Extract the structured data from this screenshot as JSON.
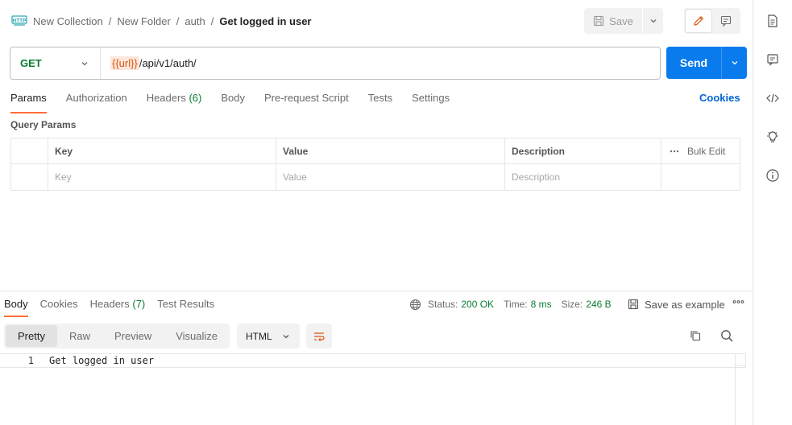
{
  "breadcrumb": {
    "items": [
      "New Collection",
      "New Folder",
      "auth"
    ],
    "separator": "/",
    "current": "Get logged in user"
  },
  "toolbar": {
    "save_label": "Save"
  },
  "request": {
    "method": "GET",
    "url_variable": "{{url}}",
    "url_path": "/api/v1/auth/",
    "send_label": "Send"
  },
  "request_tabs": [
    {
      "label": "Params",
      "count": ""
    },
    {
      "label": "Authorization",
      "count": ""
    },
    {
      "label": "Headers",
      "count": "(6)"
    },
    {
      "label": "Body",
      "count": ""
    },
    {
      "label": "Pre-request Script",
      "count": ""
    },
    {
      "label": "Tests",
      "count": ""
    },
    {
      "label": "Settings",
      "count": ""
    }
  ],
  "cookies_link": "Cookies",
  "query_params": {
    "title": "Query Params",
    "headers": {
      "key": "Key",
      "value": "Value",
      "description": "Description",
      "bulk_edit": "Bulk Edit"
    },
    "placeholders": {
      "key": "Key",
      "value": "Value",
      "description": "Description"
    }
  },
  "response_tabs": [
    {
      "label": "Body",
      "count": ""
    },
    {
      "label": "Cookies",
      "count": ""
    },
    {
      "label": "Headers",
      "count": "(7)"
    },
    {
      "label": "Test Results",
      "count": ""
    }
  ],
  "response_meta": {
    "status_label": "Status:",
    "status_value": "200 OK",
    "time_label": "Time:",
    "time_value": "8 ms",
    "size_label": "Size:",
    "size_value": "246 B",
    "save_example": "Save as example"
  },
  "format_tabs": [
    "Pretty",
    "Raw",
    "Preview",
    "Visualize"
  ],
  "language": "HTML",
  "response_body": [
    {
      "line": "1",
      "text": "Get logged in user"
    }
  ],
  "colors": {
    "accent": "#ff6c37",
    "send": "#097bed",
    "method_get": "#0a7d33",
    "link": "#0265d2",
    "variable": "#e2520d"
  }
}
